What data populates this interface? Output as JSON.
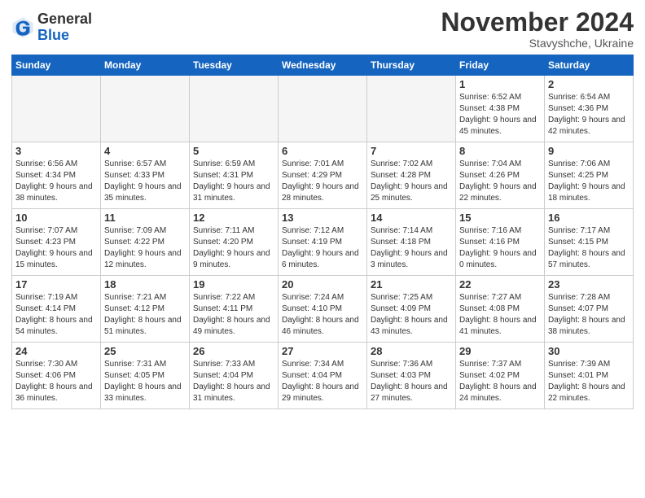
{
  "header": {
    "logo_general": "General",
    "logo_blue": "Blue",
    "month_title": "November 2024",
    "location": "Stavyshche, Ukraine"
  },
  "weekdays": [
    "Sunday",
    "Monday",
    "Tuesday",
    "Wednesday",
    "Thursday",
    "Friday",
    "Saturday"
  ],
  "weeks": [
    [
      {
        "day": "",
        "empty": true
      },
      {
        "day": "",
        "empty": true
      },
      {
        "day": "",
        "empty": true
      },
      {
        "day": "",
        "empty": true
      },
      {
        "day": "",
        "empty": true
      },
      {
        "day": "1",
        "sunrise": "Sunrise: 6:52 AM",
        "sunset": "Sunset: 4:38 PM",
        "daylight": "Daylight: 9 hours and 45 minutes."
      },
      {
        "day": "2",
        "sunrise": "Sunrise: 6:54 AM",
        "sunset": "Sunset: 4:36 PM",
        "daylight": "Daylight: 9 hours and 42 minutes."
      }
    ],
    [
      {
        "day": "3",
        "sunrise": "Sunrise: 6:56 AM",
        "sunset": "Sunset: 4:34 PM",
        "daylight": "Daylight: 9 hours and 38 minutes."
      },
      {
        "day": "4",
        "sunrise": "Sunrise: 6:57 AM",
        "sunset": "Sunset: 4:33 PM",
        "daylight": "Daylight: 9 hours and 35 minutes."
      },
      {
        "day": "5",
        "sunrise": "Sunrise: 6:59 AM",
        "sunset": "Sunset: 4:31 PM",
        "daylight": "Daylight: 9 hours and 31 minutes."
      },
      {
        "day": "6",
        "sunrise": "Sunrise: 7:01 AM",
        "sunset": "Sunset: 4:29 PM",
        "daylight": "Daylight: 9 hours and 28 minutes."
      },
      {
        "day": "7",
        "sunrise": "Sunrise: 7:02 AM",
        "sunset": "Sunset: 4:28 PM",
        "daylight": "Daylight: 9 hours and 25 minutes."
      },
      {
        "day": "8",
        "sunrise": "Sunrise: 7:04 AM",
        "sunset": "Sunset: 4:26 PM",
        "daylight": "Daylight: 9 hours and 22 minutes."
      },
      {
        "day": "9",
        "sunrise": "Sunrise: 7:06 AM",
        "sunset": "Sunset: 4:25 PM",
        "daylight": "Daylight: 9 hours and 18 minutes."
      }
    ],
    [
      {
        "day": "10",
        "sunrise": "Sunrise: 7:07 AM",
        "sunset": "Sunset: 4:23 PM",
        "daylight": "Daylight: 9 hours and 15 minutes."
      },
      {
        "day": "11",
        "sunrise": "Sunrise: 7:09 AM",
        "sunset": "Sunset: 4:22 PM",
        "daylight": "Daylight: 9 hours and 12 minutes."
      },
      {
        "day": "12",
        "sunrise": "Sunrise: 7:11 AM",
        "sunset": "Sunset: 4:20 PM",
        "daylight": "Daylight: 9 hours and 9 minutes."
      },
      {
        "day": "13",
        "sunrise": "Sunrise: 7:12 AM",
        "sunset": "Sunset: 4:19 PM",
        "daylight": "Daylight: 9 hours and 6 minutes."
      },
      {
        "day": "14",
        "sunrise": "Sunrise: 7:14 AM",
        "sunset": "Sunset: 4:18 PM",
        "daylight": "Daylight: 9 hours and 3 minutes."
      },
      {
        "day": "15",
        "sunrise": "Sunrise: 7:16 AM",
        "sunset": "Sunset: 4:16 PM",
        "daylight": "Daylight: 9 hours and 0 minutes."
      },
      {
        "day": "16",
        "sunrise": "Sunrise: 7:17 AM",
        "sunset": "Sunset: 4:15 PM",
        "daylight": "Daylight: 8 hours and 57 minutes."
      }
    ],
    [
      {
        "day": "17",
        "sunrise": "Sunrise: 7:19 AM",
        "sunset": "Sunset: 4:14 PM",
        "daylight": "Daylight: 8 hours and 54 minutes."
      },
      {
        "day": "18",
        "sunrise": "Sunrise: 7:21 AM",
        "sunset": "Sunset: 4:12 PM",
        "daylight": "Daylight: 8 hours and 51 minutes."
      },
      {
        "day": "19",
        "sunrise": "Sunrise: 7:22 AM",
        "sunset": "Sunset: 4:11 PM",
        "daylight": "Daylight: 8 hours and 49 minutes."
      },
      {
        "day": "20",
        "sunrise": "Sunrise: 7:24 AM",
        "sunset": "Sunset: 4:10 PM",
        "daylight": "Daylight: 8 hours and 46 minutes."
      },
      {
        "day": "21",
        "sunrise": "Sunrise: 7:25 AM",
        "sunset": "Sunset: 4:09 PM",
        "daylight": "Daylight: 8 hours and 43 minutes."
      },
      {
        "day": "22",
        "sunrise": "Sunrise: 7:27 AM",
        "sunset": "Sunset: 4:08 PM",
        "daylight": "Daylight: 8 hours and 41 minutes."
      },
      {
        "day": "23",
        "sunrise": "Sunrise: 7:28 AM",
        "sunset": "Sunset: 4:07 PM",
        "daylight": "Daylight: 8 hours and 38 minutes."
      }
    ],
    [
      {
        "day": "24",
        "sunrise": "Sunrise: 7:30 AM",
        "sunset": "Sunset: 4:06 PM",
        "daylight": "Daylight: 8 hours and 36 minutes."
      },
      {
        "day": "25",
        "sunrise": "Sunrise: 7:31 AM",
        "sunset": "Sunset: 4:05 PM",
        "daylight": "Daylight: 8 hours and 33 minutes."
      },
      {
        "day": "26",
        "sunrise": "Sunrise: 7:33 AM",
        "sunset": "Sunset: 4:04 PM",
        "daylight": "Daylight: 8 hours and 31 minutes."
      },
      {
        "day": "27",
        "sunrise": "Sunrise: 7:34 AM",
        "sunset": "Sunset: 4:04 PM",
        "daylight": "Daylight: 8 hours and 29 minutes."
      },
      {
        "day": "28",
        "sunrise": "Sunrise: 7:36 AM",
        "sunset": "Sunset: 4:03 PM",
        "daylight": "Daylight: 8 hours and 27 minutes."
      },
      {
        "day": "29",
        "sunrise": "Sunrise: 7:37 AM",
        "sunset": "Sunset: 4:02 PM",
        "daylight": "Daylight: 8 hours and 24 minutes."
      },
      {
        "day": "30",
        "sunrise": "Sunrise: 7:39 AM",
        "sunset": "Sunset: 4:01 PM",
        "daylight": "Daylight: 8 hours and 22 minutes."
      }
    ]
  ]
}
